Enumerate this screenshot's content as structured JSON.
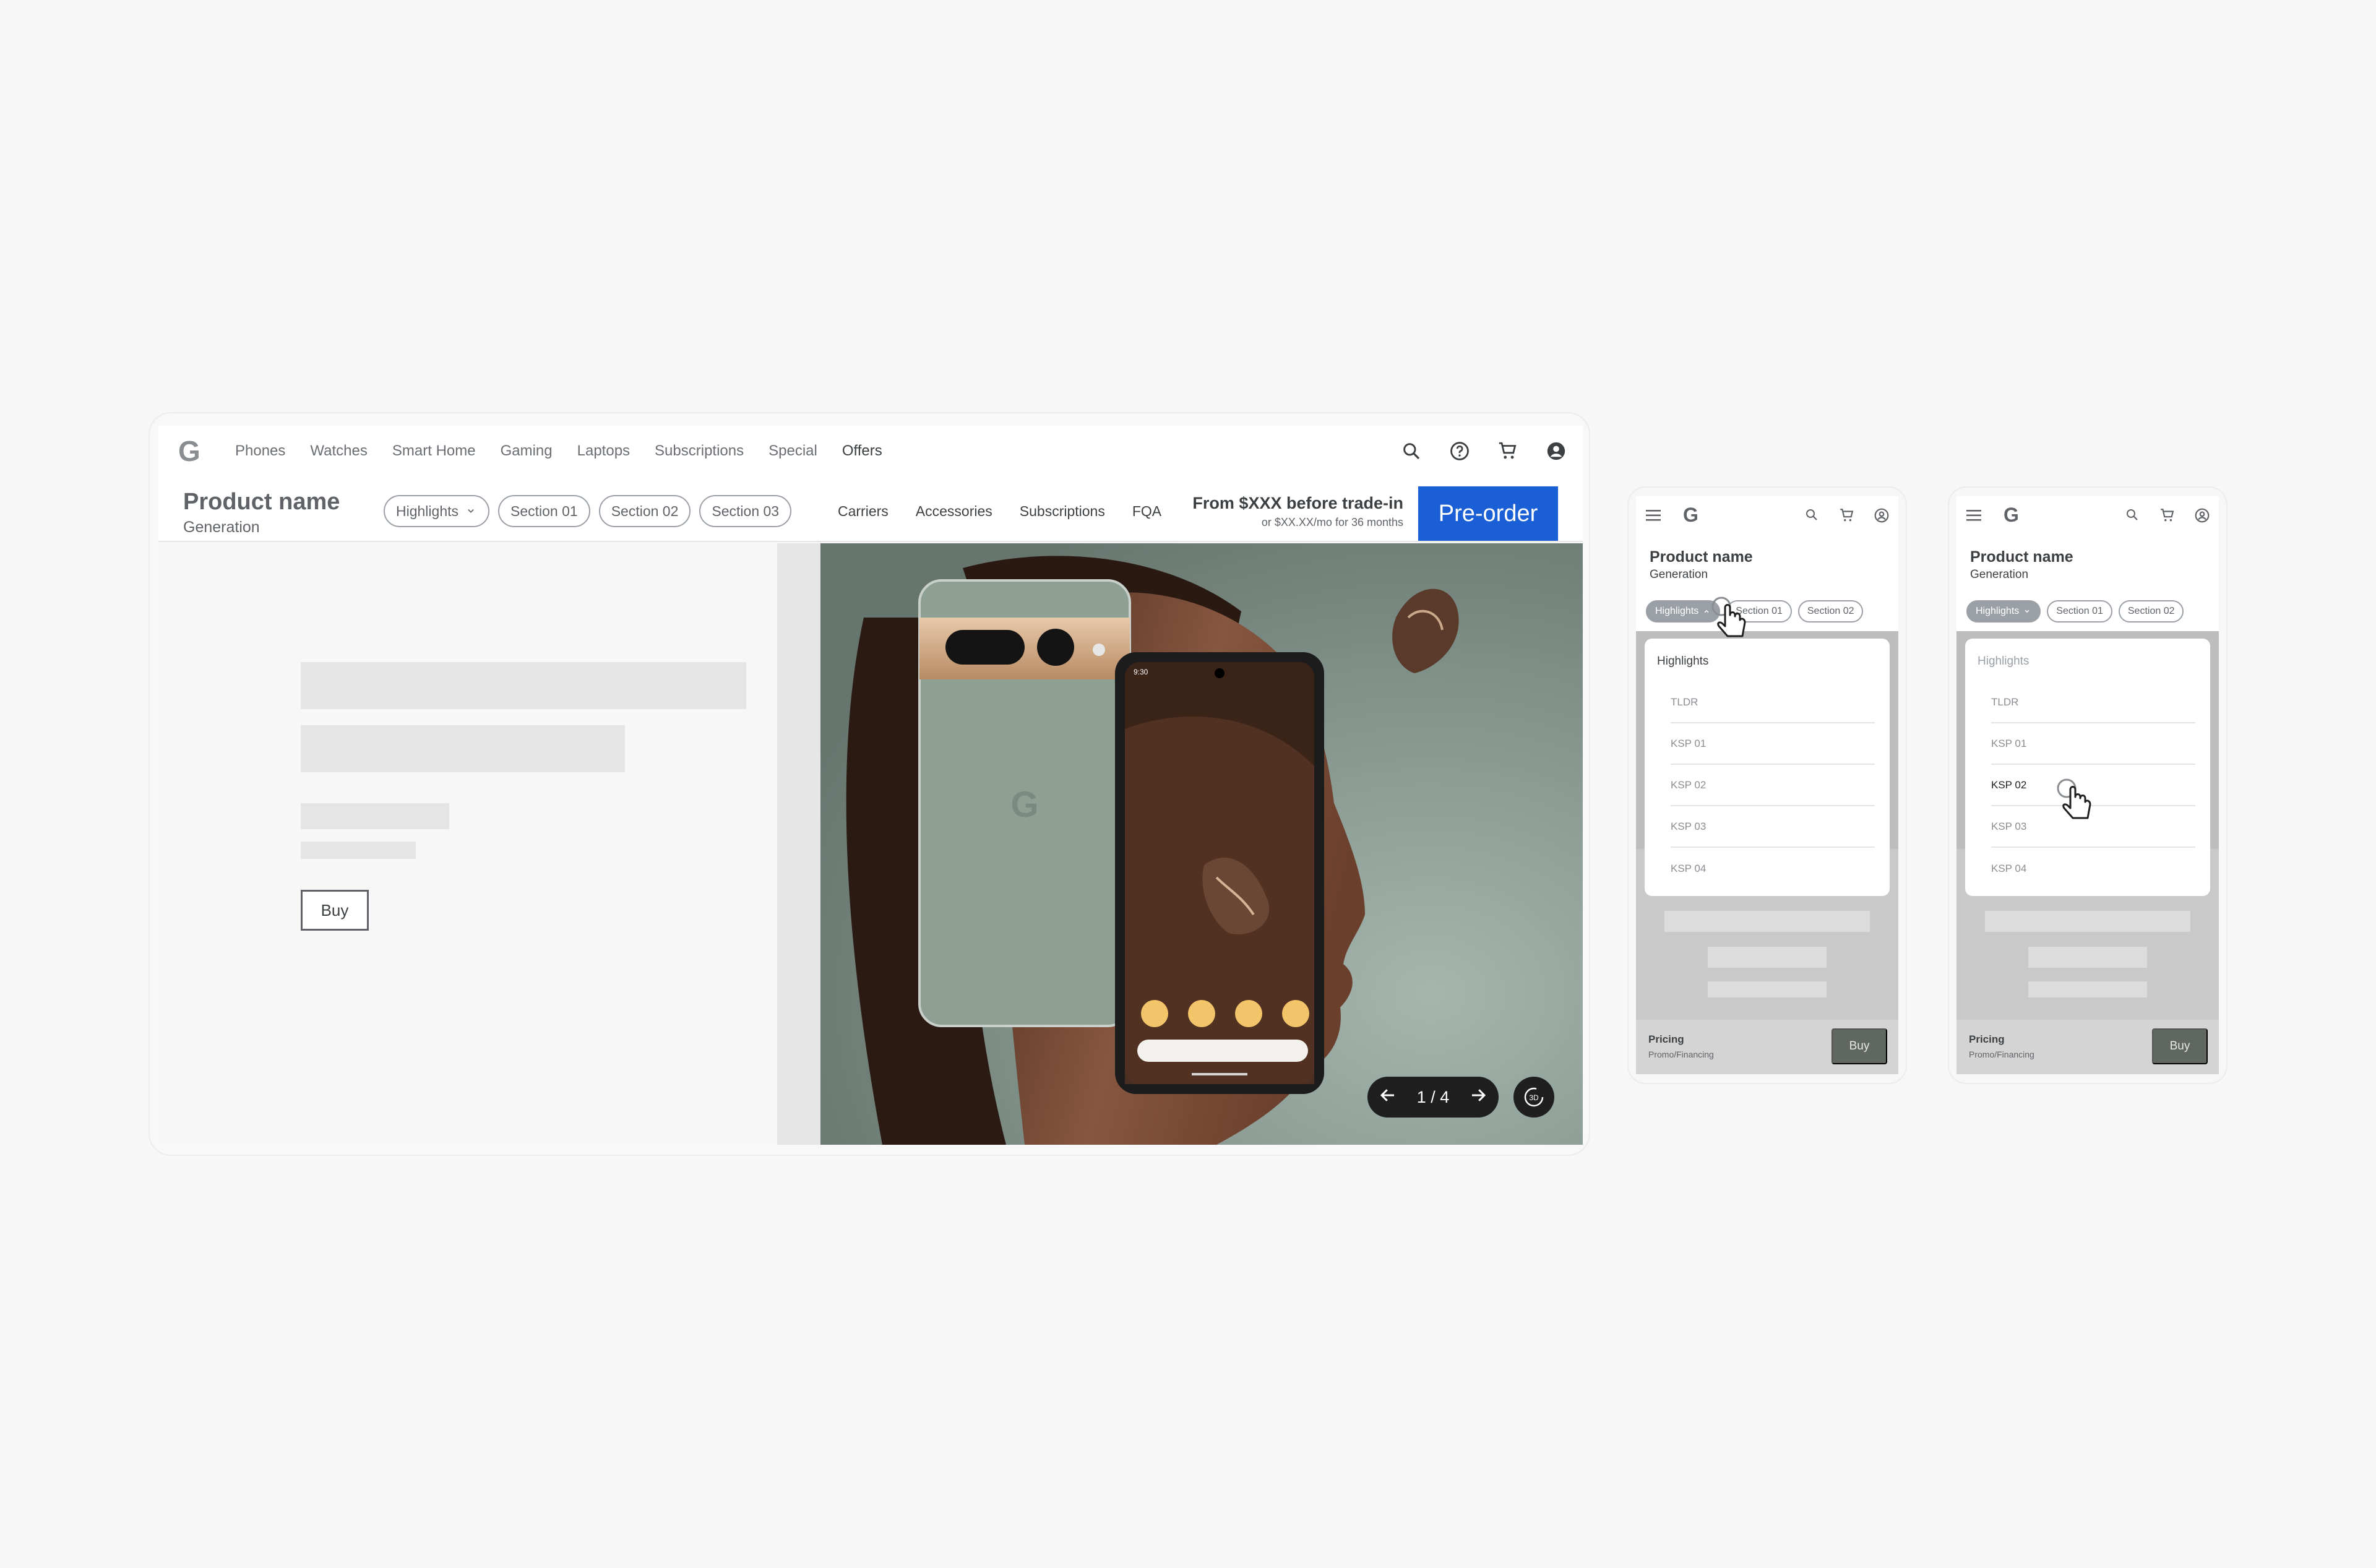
{
  "desktop": {
    "logo": "G",
    "nav": [
      "Phones",
      "Watches",
      "Smart Home",
      "Gaming",
      "Laptops",
      "Subscriptions",
      "Special",
      "Offers"
    ],
    "product": {
      "name": "Product name",
      "generation": "Generation"
    },
    "chips": [
      "Highlights",
      "Section 01",
      "Section 02",
      "Section 03"
    ],
    "links": [
      "Carriers",
      "Accessories",
      "Subscriptions",
      "FQA"
    ],
    "price_main": "From $XXX before trade-in",
    "price_sub": "or $XX.XX/mo for 36 months",
    "preorder_label": "Pre-order",
    "buy_label": "Buy",
    "pager_label": "1 / 4",
    "phone_status_time": "9:30",
    "rotate_label": "3D"
  },
  "mobile_a": {
    "logo": "G",
    "product": {
      "name": "Product name",
      "generation": "Generation"
    },
    "chips": [
      "Highlights",
      "Section 01",
      "Section 02"
    ],
    "dropdown_heading": "Highlights",
    "dropdown_items": [
      "TLDR",
      "KSP 01",
      "KSP 02",
      "KSP 03",
      "KSP 04"
    ],
    "footer_pricing": "Pricing",
    "footer_promo": "Promo/Financing",
    "buy_label": "Buy"
  },
  "mobile_b": {
    "logo": "G",
    "product": {
      "name": "Product name",
      "generation": "Generation"
    },
    "chips": [
      "Highlights",
      "Section 01",
      "Section 02"
    ],
    "dropdown_heading": "Highlights",
    "dropdown_items": [
      "TLDR",
      "KSP 01",
      "KSP 02",
      "KSP 03",
      "KSP 04"
    ],
    "selected_item": "KSP 02",
    "footer_pricing": "Pricing",
    "footer_promo": "Promo/Financing",
    "buy_label": "Buy"
  },
  "colors": {
    "accent": "#1a5fd6",
    "chip_border": "#9aa0a6",
    "dark": "#1f1f1f"
  }
}
